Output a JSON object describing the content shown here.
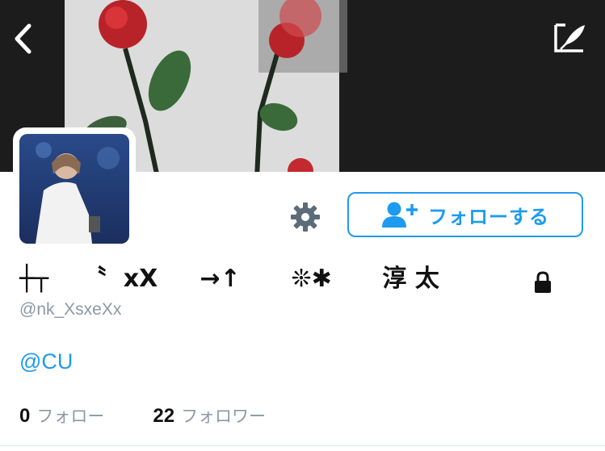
{
  "header": {
    "back_icon": "chevron-left-icon",
    "compose_icon": "compose-feather-icon"
  },
  "profile": {
    "display_name": "┼┬    〝  xX     →↑      ❊✱      淳 太",
    "handle": "@nk_XsxeXx",
    "bio_link": "@CU",
    "protected": true,
    "lock_icon": "lock-icon"
  },
  "actions": {
    "settings_icon": "gear-icon",
    "follow_icon": "add-user-icon",
    "follow_label": "フォローする"
  },
  "stats": {
    "following_count": "0",
    "following_label": "フォロー",
    "followers_count": "22",
    "followers_label": "フォロワー"
  },
  "colors": {
    "accent": "#1d9bf0",
    "banner_bg": "#1c1c1c",
    "muted_text": "#8b98a5",
    "gear": "#5b6b7a"
  }
}
